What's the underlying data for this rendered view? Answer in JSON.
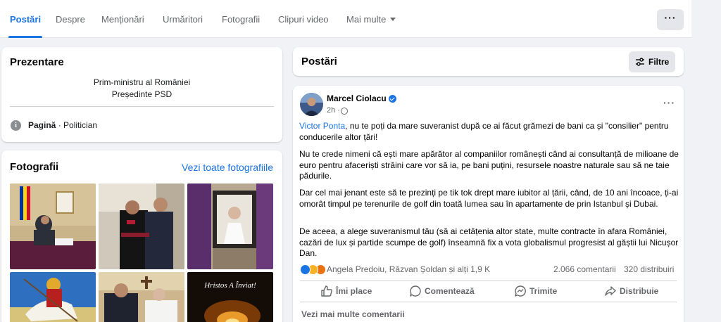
{
  "tabs": [
    {
      "label": "Postări",
      "active": true
    },
    {
      "label": "Despre"
    },
    {
      "label": "Menționări"
    },
    {
      "label": "Urmăritori"
    },
    {
      "label": "Fotografii"
    },
    {
      "label": "Clipuri video"
    },
    {
      "label": "Mai multe"
    }
  ],
  "tabbar_more": "···",
  "intro": {
    "title": "Prezentare",
    "bio_line1": "Prim-ministru al României",
    "bio_line2": "Președinte PSD",
    "page_type_bold": "Pagină",
    "page_type_rest": " · Politician"
  },
  "photos": {
    "title": "Fotografii",
    "see_all": "Vezi toate fotografiile",
    "photo6_caption": "Hristos A Înviat!"
  },
  "posts_header": {
    "title": "Postări",
    "filter_label": "Filtre"
  },
  "post": {
    "author": "Marcel Ciolacu",
    "time": "2h ·",
    "menu": "···",
    "mention": "Victor Ponta",
    "p1_rest": ", nu te poți da mare suveranist după ce ai făcut grămezi de bani ca și \"consilier\" pentru conducerile altor țări!",
    "p2": "Nu te crede nimeni că ești mare apărător al companiilor românești când ai consultanță de milioane de euro pentru afaceriști străini care vor să ia, pe bani puțini, resursele noastre naturale sau să ne taie pădurile.",
    "p3": "Dar cel mai jenant este să te prezinți pe tik tok drept mare iubitor al țării, când, de 10 ani încoace, ți-ai omorât timpul pe terenurile de golf din toată lumea sau în apartamente de prin Istanbul și Dubai.",
    "p4": "De aceea, a alege suveranismul tău (să ai cetățenia altor state, multe contracte în afara României, cazări de lux și partide scumpe de golf) înseamnă fix a vota globalismul progresist al găștii lui Nicușor Dan.",
    "reactors": "Angela Predoiu, Răzvan Șoldan și alți 1,9 K",
    "comments_count": "2.066 comentarii",
    "shares_count": "320 distribuiri",
    "actions": {
      "like": "Îmi place",
      "comment": "Comentează",
      "send": "Trimite",
      "share": "Distribuie"
    },
    "more_comments": "Vezi mai multe comentarii"
  },
  "colors": {
    "accent": "#1b74e4",
    "background": "#f0f2f5",
    "muted_text": "#65676b"
  }
}
